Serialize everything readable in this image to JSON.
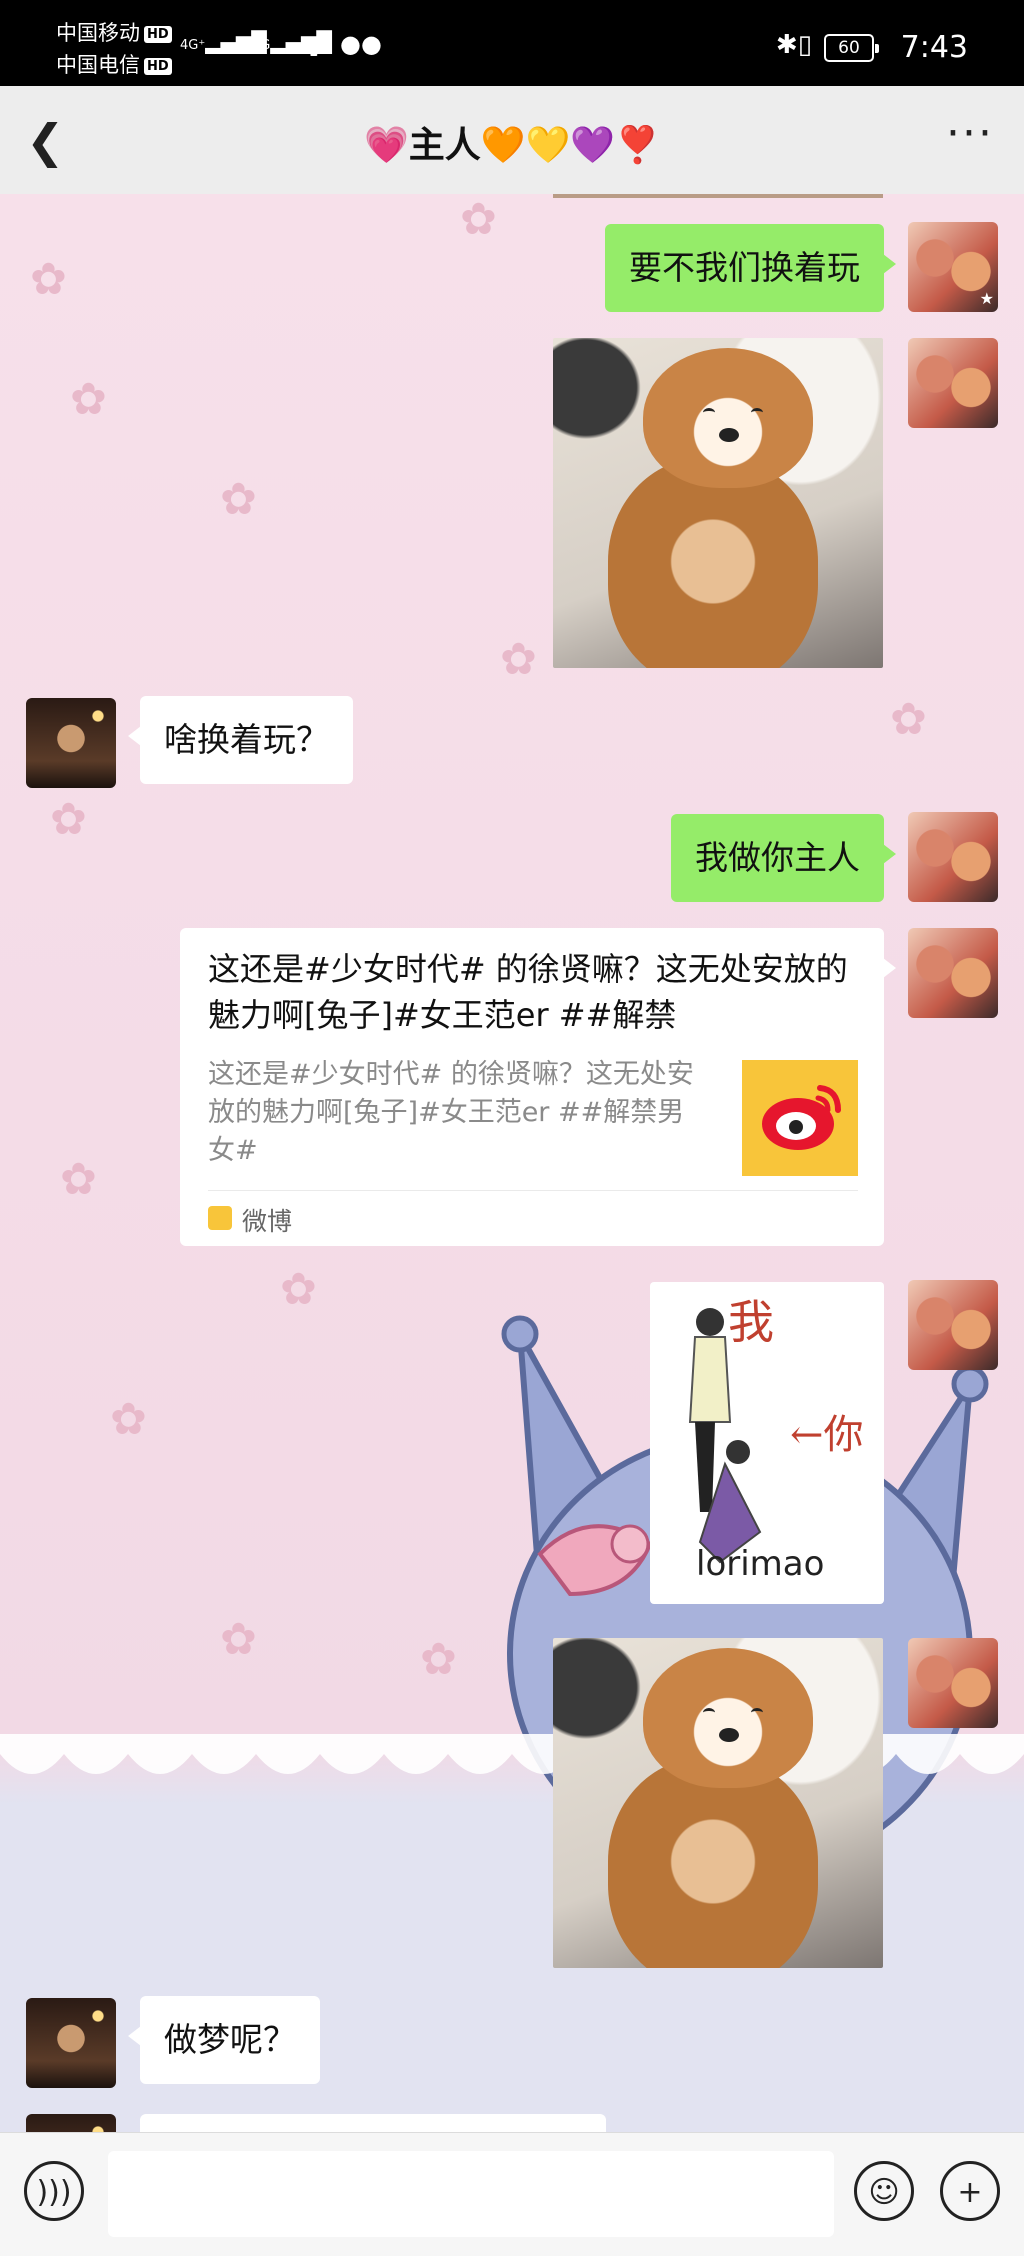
{
  "status_bar": {
    "carrier1": "中国移动",
    "carrier2": "中国电信",
    "hd": "HD",
    "network1": "4G⁺",
    "network2": "4G",
    "battery": "60",
    "time": "7:43"
  },
  "header": {
    "title": "💗主人🧡💛💜❣️"
  },
  "messages": [
    {
      "from": "me",
      "type": "text",
      "text": "要不我们换着玩"
    },
    {
      "from": "me",
      "type": "image",
      "image": "shiba-dog"
    },
    {
      "from": "friend",
      "type": "text",
      "text": "啥换着玩？"
    },
    {
      "from": "me",
      "type": "text",
      "text": "我做你主人"
    },
    {
      "from": "me",
      "type": "link-card",
      "title": "这还是#少女时代# 的徐贤嘛？这无处安放的魅力啊[兔子]#女王范er ##解禁",
      "description": "这还是#少女时代# 的徐贤嘛？这无处安放的魅力啊[兔子]#女王范er ##解禁男女#",
      "source": "微博"
    },
    {
      "from": "me",
      "type": "image",
      "image": "sketch",
      "annotations": [
        "我",
        "←你"
      ],
      "watermark": "lorimao"
    },
    {
      "from": "me",
      "type": "image",
      "image": "shiba-dog"
    },
    {
      "from": "friend",
      "type": "text",
      "text": "做梦呢？"
    }
  ],
  "colors": {
    "outgoing_bubble": "#95ec69",
    "incoming_bubble": "#ffffff",
    "header_bg": "#ededed"
  },
  "input_bar": {
    "voice_icon": "voice-icon",
    "emoji_icon": "emoji-icon",
    "add_icon": "add-icon",
    "placeholder": ""
  }
}
